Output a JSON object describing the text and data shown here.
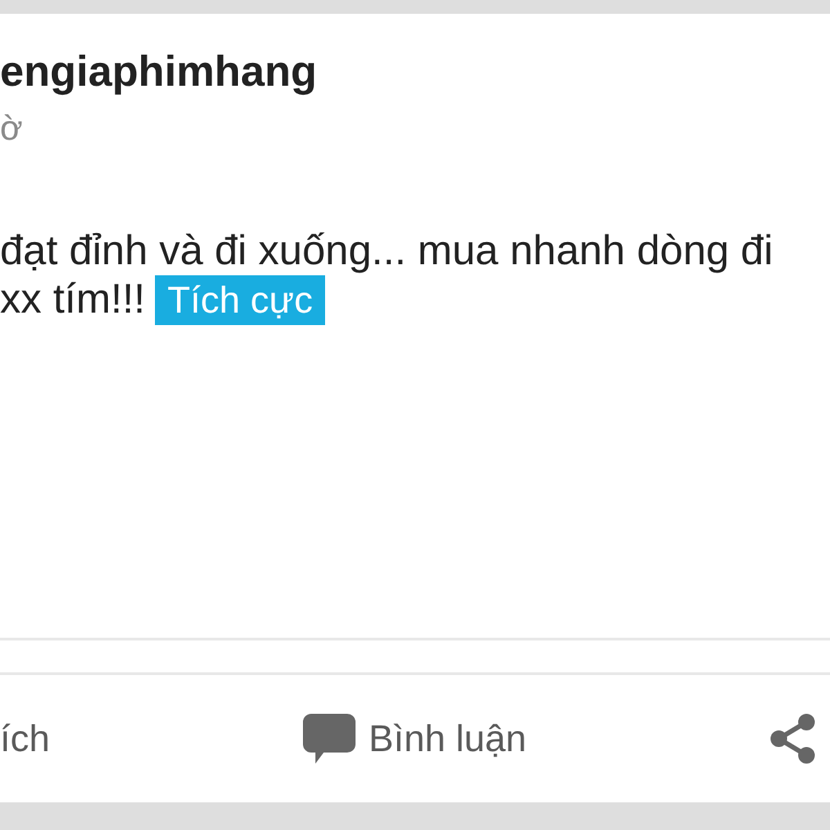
{
  "post": {
    "author": "engiaphimhang",
    "time": "ờ",
    "lines": [
      "đạt đỉnh và đi xuống... mua nhanh dòng đi",
      "xx tím!!!"
    ],
    "tag": "Tích cực"
  },
  "actions": [
    {
      "kind": "like",
      "label": "ích"
    },
    {
      "kind": "comment",
      "label": "Bình luận"
    },
    {
      "kind": "share"
    }
  ]
}
